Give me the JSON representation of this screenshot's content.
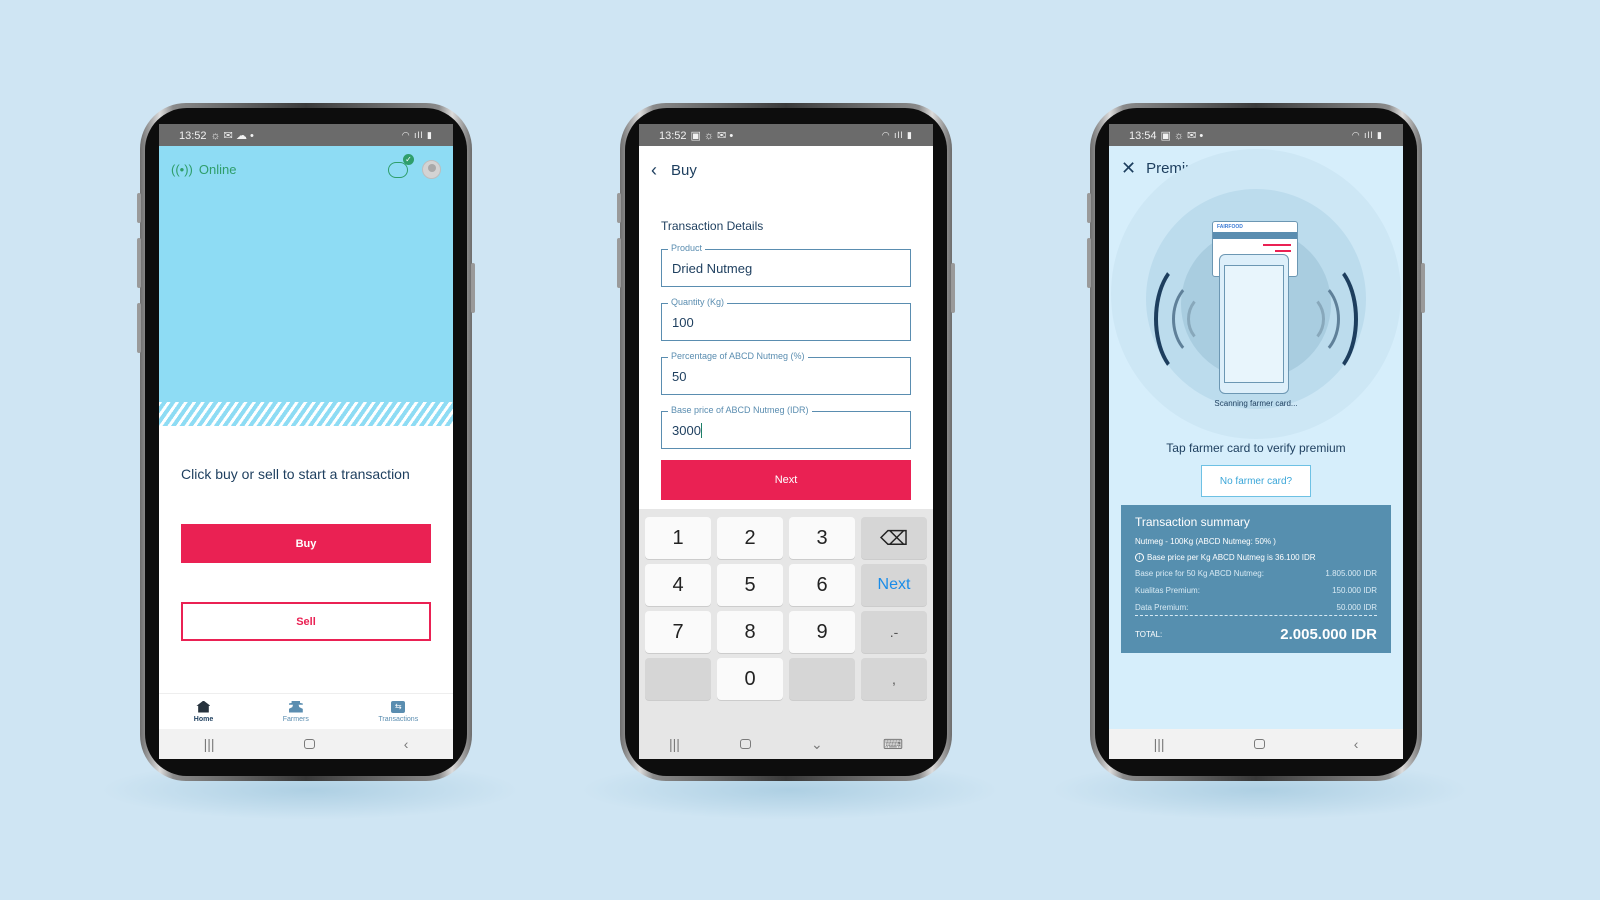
{
  "colors": {
    "background": "#cfe5f3",
    "brand_red": "#ea2153",
    "navy": "#1d3e5e",
    "hero_blue": "#8edcf4",
    "summary_blue": "#568faf",
    "online_green": "#2f9e6b"
  },
  "phone1": {
    "status": {
      "time": "13:52",
      "icons": "☼ ✉ ☁ •",
      "right": "◠ ıll ▮"
    },
    "connection_label": "Online",
    "prompt": "Click buy or sell to start a transaction",
    "buy_label": "Buy",
    "sell_label": "Sell",
    "tabs": [
      {
        "label": "Home",
        "icon": "home-icon",
        "active": true
      },
      {
        "label": "Farmers",
        "icon": "farmer-icon",
        "active": false
      },
      {
        "label": "Transactions",
        "icon": "transactions-icon",
        "active": false
      }
    ],
    "nav": {
      "recents": "|||",
      "back": "‹"
    }
  },
  "phone2": {
    "status": {
      "time": "13:52",
      "icons": "▣ ☼ ✉ •",
      "right": "◠ ıll ▮"
    },
    "title": "Buy",
    "section_title": "Transaction Details",
    "fields": [
      {
        "label": "Product",
        "value": "Dried Nutmeg"
      },
      {
        "label": "Quantity (Kg)",
        "value": "100"
      },
      {
        "label": "Percentage of ABCD Nutmeg (%)",
        "value": "50"
      },
      {
        "label": "Base price of ABCD Nutmeg (IDR)",
        "value": "3000"
      }
    ],
    "next_label": "Next",
    "keypad": {
      "keys": [
        "1",
        "2",
        "3",
        "⌫",
        "4",
        "5",
        "6",
        "Next",
        "7",
        "8",
        "9",
        ".-",
        "",
        "0",
        "",
        ","
      ]
    },
    "nav": {
      "recents": "|||",
      "hide": "⌄",
      "keyboard": "⌨"
    }
  },
  "phone3": {
    "status": {
      "time": "13:54",
      "icons": "▣ ☼ ✉ •",
      "right": "◠ ıll ▮"
    },
    "title": "Premium verification",
    "card_brand": "FAIRFOOD",
    "scanning_text": "Scanning farmer card...",
    "instruction": "Tap farmer card to verify premium",
    "no_card_label": "No farmer card?",
    "summary": {
      "title": "Transaction summary",
      "subtitle": "Nutmeg - 100Kg (ABCD Nutmeg: 50% )",
      "info": "Base price per Kg  ABCD Nutmeg is 36.100 IDR",
      "rows": [
        {
          "label": "Base price for 50 Kg ABCD Nutmeg:",
          "value": "1.805.000 IDR"
        },
        {
          "label": "Kualitas Premium:",
          "value": "150.000 IDR"
        },
        {
          "label": "Data Premium:",
          "value": "50.000 IDR"
        }
      ],
      "total_label": "TOTAL:",
      "total_value": "2.005.000 IDR"
    },
    "nav": {
      "recents": "|||",
      "back": "‹"
    }
  }
}
